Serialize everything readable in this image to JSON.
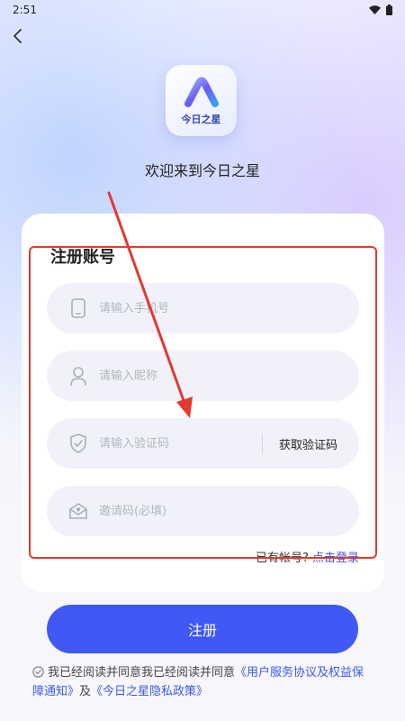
{
  "status_bar": {
    "time": "2:51"
  },
  "icons": {
    "back": "chevron-left-icon",
    "phone": "phone-icon",
    "user": "user-icon",
    "shield": "shield-check-icon",
    "invite": "envelope-heart-icon",
    "check": "check-circle-icon"
  },
  "logo": {
    "text": "今日之星"
  },
  "welcome": "欢迎来到今日之星",
  "form": {
    "title": "注册账号",
    "phone_placeholder": "请输入手机号",
    "nickname_placeholder": "请输入昵称",
    "code_placeholder": "请输入验证码",
    "get_code_label": "获取验证码",
    "invite_placeholder": "邀请码(必填)",
    "login_prompt": "已有帐号?",
    "login_link": "点击登录"
  },
  "register_button": "注册",
  "agreement": {
    "prefix": "我已经阅读并同意我已经阅读并同意",
    "link1": "《用户服务协议及权益保障通知》",
    "conj": "及",
    "link2": "《今日之星隐私政策》"
  },
  "colors": {
    "primary": "#3f58f6",
    "link": "#3d57f5",
    "annotation": "#e23a2f"
  }
}
